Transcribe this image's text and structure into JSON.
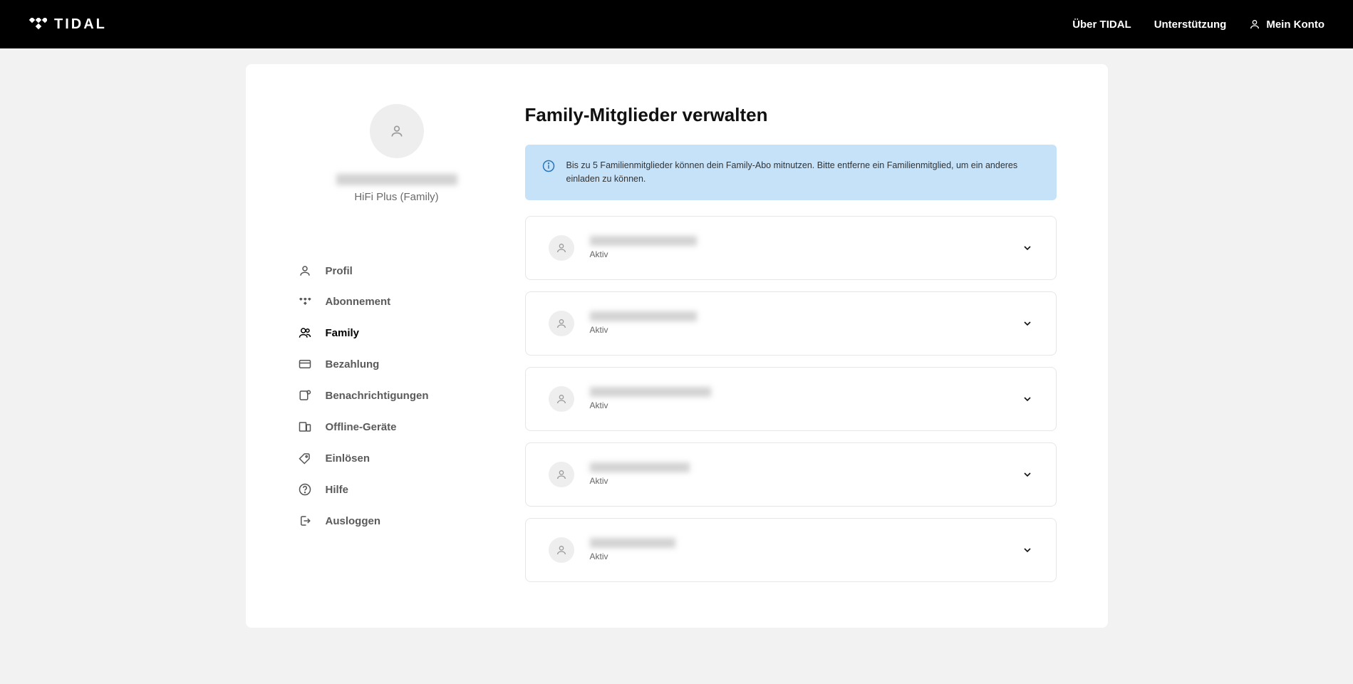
{
  "header": {
    "brand": "TIDAL",
    "nav_about": "Über TIDAL",
    "nav_support": "Unterstützung",
    "nav_account": "Mein Konto"
  },
  "profile": {
    "plan": "HiFi Plus (Family)"
  },
  "sidebar": {
    "items": [
      {
        "label": "Profil",
        "icon": "user-icon",
        "active": false
      },
      {
        "label": "Abonnement",
        "icon": "tidal-dots-icon",
        "active": false
      },
      {
        "label": "Family",
        "icon": "people-icon",
        "active": true
      },
      {
        "label": "Bezahlung",
        "icon": "card-icon",
        "active": false
      },
      {
        "label": "Benachrichtigungen",
        "icon": "bell-dot-icon",
        "active": false
      },
      {
        "label": "Offline-Geräte",
        "icon": "devices-icon",
        "active": false
      },
      {
        "label": "Einlösen",
        "icon": "tag-icon",
        "active": false
      },
      {
        "label": "Hilfe",
        "icon": "help-icon",
        "active": false
      },
      {
        "label": "Ausloggen",
        "icon": "logout-icon",
        "active": false
      }
    ]
  },
  "main": {
    "title": "Family-Mitglieder verwalten",
    "info": "Bis zu 5 Familienmitglieder können dein Family-Abo mitnutzen. Bitte entferne ein Familienmitglied, um ein anderes einladen zu können.",
    "members": [
      {
        "status": "Aktiv",
        "name_width": 150
      },
      {
        "status": "Aktiv",
        "name_width": 150
      },
      {
        "status": "Aktiv",
        "name_width": 170
      },
      {
        "status": "Aktiv",
        "name_width": 140
      },
      {
        "status": "Aktiv",
        "name_width": 120
      }
    ]
  }
}
